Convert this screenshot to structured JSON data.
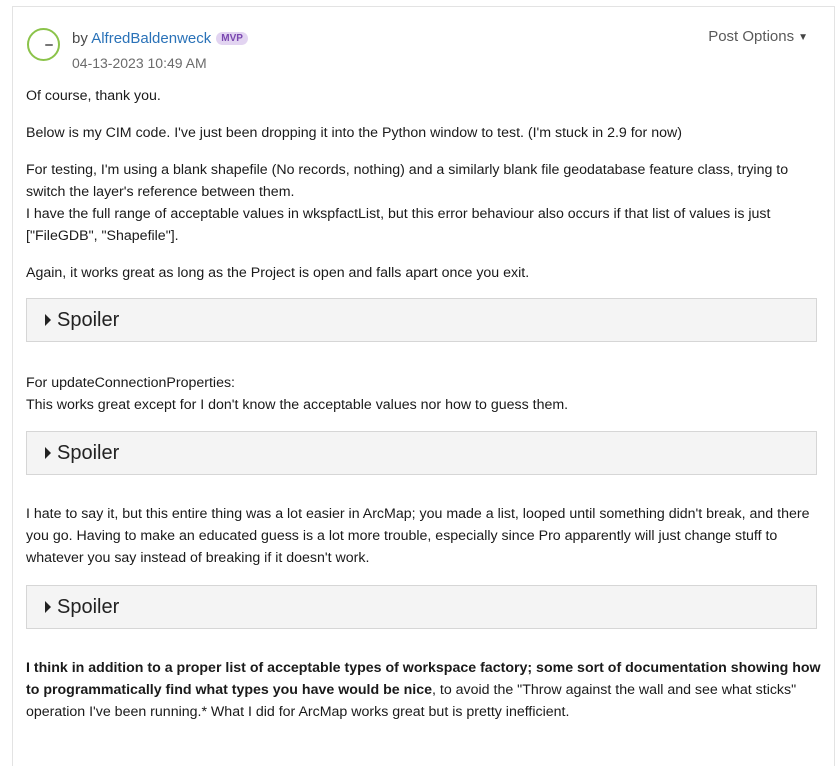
{
  "post": {
    "by_prefix": "by",
    "author": "AlfredBaldenweck",
    "badge": "MVP",
    "date": "04-13-2023",
    "time": "10:49 AM",
    "options_label": "Post Options",
    "options_caret": "▼"
  },
  "body": {
    "p1": "Of course, thank you.",
    "p2": "Below is my CIM code. I've just been dropping it into the Python window to test. (I'm stuck in 2.9 for now)",
    "p3_line1": "For testing, I'm using a blank shapefile (No records, nothing) and a similarly blank file geodatabase feature class, trying to switch the layer's reference between them.",
    "p3_line2": "I have the full range of acceptable values in wkspfactList, but this error behaviour also occurs if that list of values is just [\"FileGDB\", \"Shapefile\"].",
    "p4": "Again, it works great as long as the Project is open and falls apart once you exit.",
    "spoiler1": "Spoiler",
    "p5_line1": "For updateConnectionProperties:",
    "p5_line2": "This works great except for I don't know the acceptable values nor how to guess them.",
    "spoiler2": "Spoiler",
    "p6": "I hate to say it, but this entire thing was a lot easier in ArcMap; you made a list, looped until something didn't break, and there you go. Having to make an educated guess is a lot more trouble, especially since Pro apparently will just change stuff to whatever you say instead of breaking if it doesn't work.",
    "spoiler3": "Spoiler",
    "p7_bold": "I think in addition to a proper list of acceptable types of workspace factory; some sort of documentation showing how to programmatically find what types you have would be nice",
    "p7_rest": ", to avoid the \"Throw against the wall and see what sticks\" operation I've been running.* What I did for ArcMap works great but is pretty inefficient."
  }
}
